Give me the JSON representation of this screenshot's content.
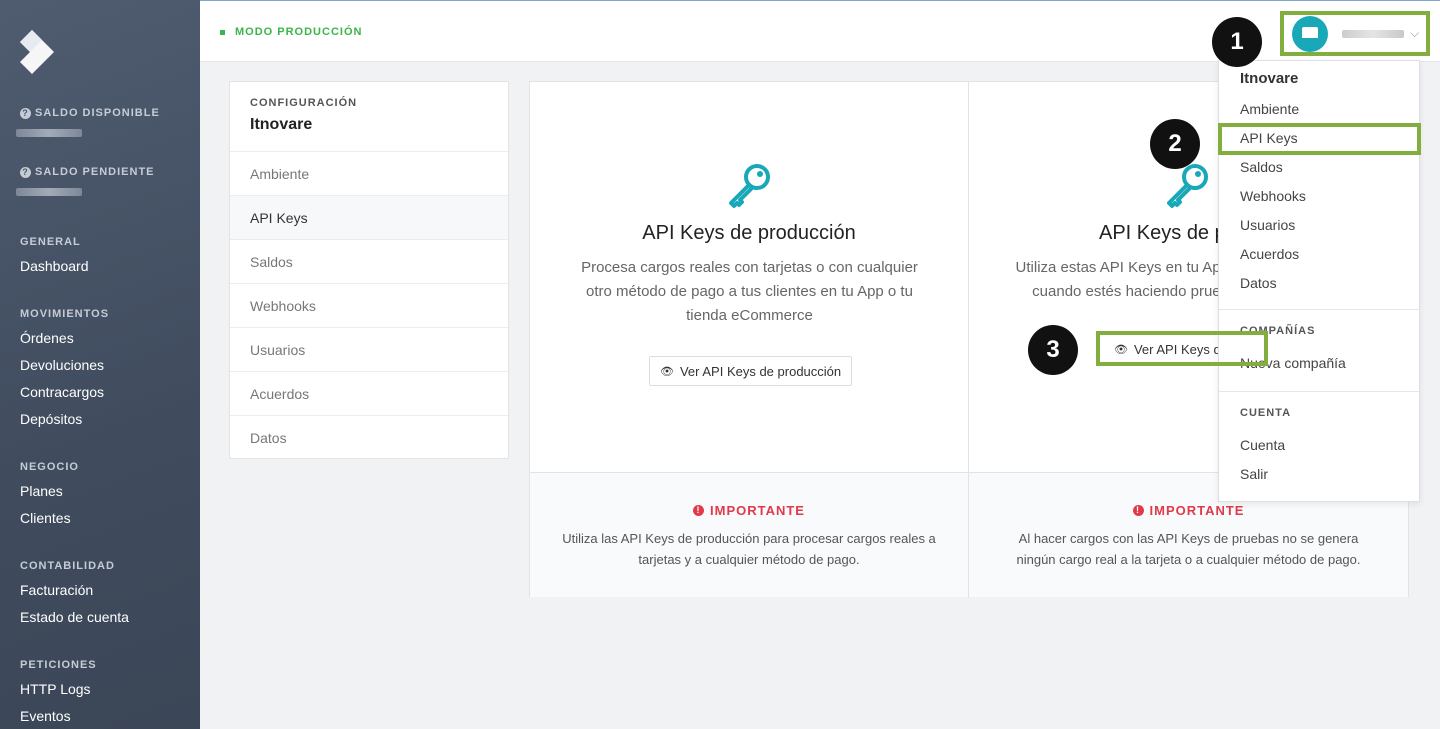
{
  "sidebar": {
    "balance_available": "SALDO DISPONIBLE",
    "balance_pending": "SALDO PENDIENTE",
    "groups": [
      {
        "heading": "GENERAL",
        "items": [
          "Dashboard"
        ]
      },
      {
        "heading": "MOVIMIENTOS",
        "items": [
          "Órdenes",
          "Devoluciones",
          "Contracargos",
          "Depósitos"
        ]
      },
      {
        "heading": "NEGOCIO",
        "items": [
          "Planes",
          "Clientes"
        ]
      },
      {
        "heading": "CONTABILIDAD",
        "items": [
          "Facturación",
          "Estado de cuenta"
        ]
      },
      {
        "heading": "PETICIONES",
        "items": [
          "HTTP Logs",
          "Eventos"
        ]
      }
    ]
  },
  "topbar": {
    "mode": "MODO PRODUCCIÓN",
    "chevron": "⌵"
  },
  "config": {
    "label": "CONFIGURACIÓN",
    "company": "Itnovare",
    "items": [
      "Ambiente",
      "API Keys",
      "Saldos",
      "Webhooks",
      "Usuarios",
      "Acuerdos",
      "Datos"
    ]
  },
  "cards": {
    "production": {
      "title": "API Keys de producción",
      "desc": "Procesa cargos reales con tarjetas o con cualquier otro método de pago a tus clientes en tu App o tu tienda eCommerce",
      "button": "Ver API Keys de producción",
      "important": "IMPORTANTE",
      "note": "Utiliza las API Keys de producción para procesar cargos reales a tarjetas y a cualquier método de pago."
    },
    "test": {
      "title": "API Keys de p",
      "desc": "Utiliza estas API Keys en tu App cuando estés haciendo prueb",
      "button": "Ver API Keys de",
      "important": "IMPORTANTE",
      "note": "Al hacer cargos con las API Keys de pruebas no se genera ningún cargo real a la tarjeta o a cualquier método de pago."
    }
  },
  "dropdown": {
    "title": "Itnovare",
    "items": [
      "Ambiente",
      "API Keys",
      "Saldos",
      "Webhooks",
      "Usuarios",
      "Acuerdos",
      "Datos"
    ],
    "companies_heading": "COMPAÑÍAS",
    "new_company": "Nueva compañía",
    "account_heading": "CUENTA",
    "account_items": [
      "Cuenta",
      "Salir"
    ]
  },
  "annotations": [
    "1",
    "2",
    "3"
  ],
  "colors": {
    "accent_green": "#82ad3f",
    "mode_green": "#3bb54a",
    "important_red": "#e03a4a",
    "teal": "#19a8b8"
  }
}
